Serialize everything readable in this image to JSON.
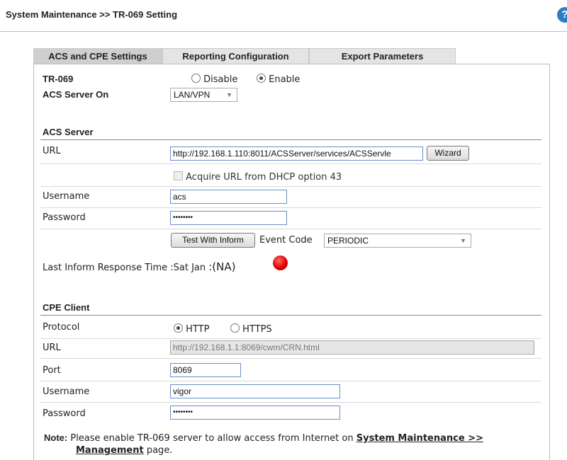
{
  "header": {
    "title": "System Maintenance >> TR-069 Setting",
    "help_icon": "?"
  },
  "tabs": [
    {
      "label": "ACS and CPE Settings",
      "active": true
    },
    {
      "label": "Reporting Configuration",
      "active": false
    },
    {
      "label": "Export Parameters",
      "active": false
    }
  ],
  "tr069": {
    "label": "TR-069",
    "disable_label": "Disable",
    "enable_label": "Enable",
    "selected": "Enable"
  },
  "acs_server_on": {
    "label": "ACS Server On",
    "value": "LAN/VPN"
  },
  "acs_server": {
    "heading": "ACS Server",
    "url_label": "URL",
    "url_value": "http://192.168.1.110:8011/ACSServer/services/ACSServle",
    "wizard_label": "Wizard",
    "dhcp_label": "Acquire URL from DHCP option 43",
    "username_label": "Username",
    "username_value": "acs",
    "password_label": "Password",
    "password_value": "••••••••",
    "test_button": "Test With Inform",
    "event_code_label": "Event Code",
    "event_code_value": "PERIODIC",
    "last_inform_label": "Last Inform Response Time :Sat Jan",
    "last_inform_value": ":(NA)",
    "status_color": "#e00000"
  },
  "cpe_client": {
    "heading": "CPE Client",
    "protocol_label": "Protocol",
    "http_label": "HTTP",
    "https_label": "HTTPS",
    "protocol_selected": "HTTP",
    "url_label": "URL",
    "url_value": "http://192.168.1.1:8069/cwm/CRN.html",
    "port_label": "Port",
    "port_value": "8069",
    "username_label": "Username",
    "username_value": "vigor",
    "password_label": "Password",
    "password_value": "••••••••"
  },
  "note": {
    "prefix": "Note:",
    "text": "Please enable TR-069 server to allow access from Internet on",
    "link_text": "System Maintenance >>",
    "link_text2": "Management",
    "suffix": "page."
  }
}
